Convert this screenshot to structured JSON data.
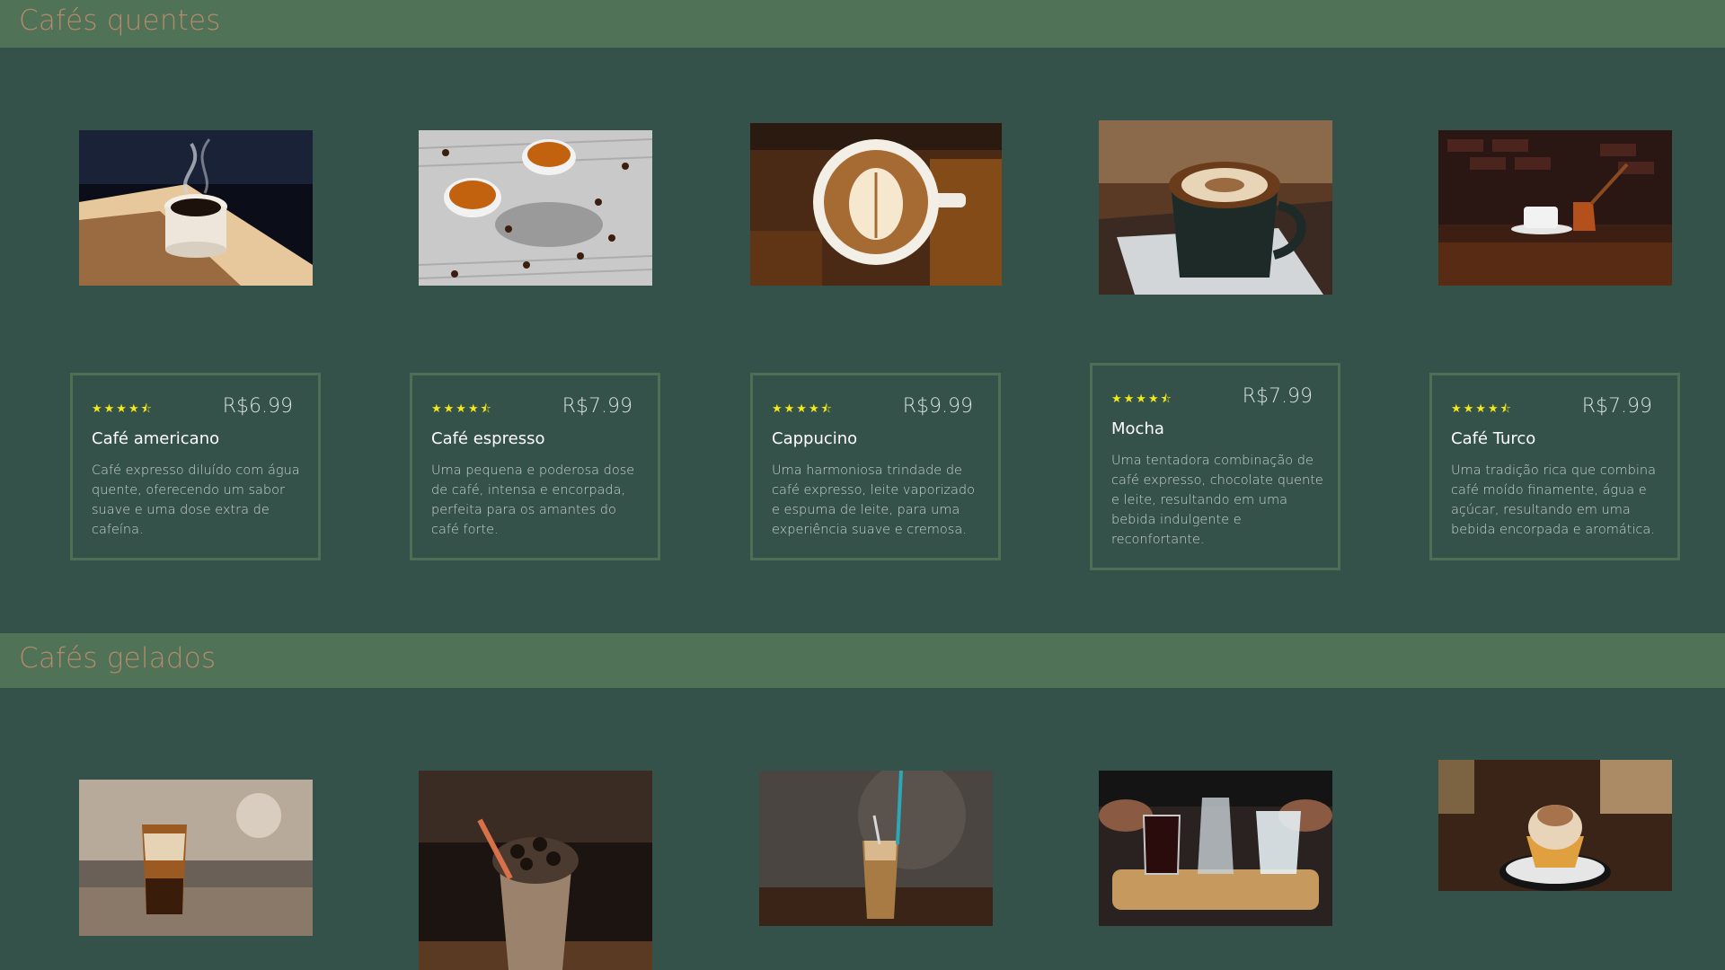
{
  "sections": [
    {
      "title": "Cafés quentes",
      "products": [
        {
          "name": "Café americano",
          "price": "R$6.99",
          "rating": 4.5,
          "stars": "★★★★⯪",
          "description": "Café expresso diluído com água quente, oferecendo um sabor suave e uma dose extra de cafeína.",
          "image_icon": "hot-americano-cup-image"
        },
        {
          "name": "Café espresso",
          "price": "R$7.99",
          "rating": 4.5,
          "stars": "★★★★⯪",
          "description": "Uma pequena e poderosa dose de café, intensa e encorpada, perfeita para os amantes do café forte.",
          "image_icon": "espresso-cups-image"
        },
        {
          "name": "Cappucino",
          "price": "R$9.99",
          "rating": 4.5,
          "stars": "★★★★⯪",
          "description": "Uma harmoniosa trindade de café expresso, leite vaporizado e espuma de leite, para uma experiência suave e cremosa.",
          "image_icon": "cappuccino-latte-art-image"
        },
        {
          "name": "Mocha",
          "price": "R$7.99",
          "rating": 4.5,
          "stars": "★★★★⯪",
          "description": "Uma tentadora combinação de café expresso, chocolate quente e leite, resultando em uma bebida indulgente e reconfortante.",
          "image_icon": "mocha-cup-image"
        },
        {
          "name": "Café Turco",
          "price": "R$7.99",
          "rating": 4.5,
          "stars": "★★★★⯪",
          "description": "Uma tradição rica que combina café moído finamente, água e açúcar, resultando em uma bebida encorpada e aromática.",
          "image_icon": "turkish-coffee-pot-image"
        }
      ]
    },
    {
      "title": "Cafés gelados",
      "products": [
        {
          "image_icon": "iced-latte-glass-image"
        },
        {
          "image_icon": "frappe-cookies-cup-image"
        },
        {
          "image_icon": "iced-coffee-straw-image"
        },
        {
          "image_icon": "cold-brew-tray-image"
        },
        {
          "image_icon": "affogato-dessert-image"
        }
      ]
    }
  ],
  "colors": {
    "background": "#34524a",
    "header_bar": "#507257",
    "header_text": "#b58a6a",
    "card_border": "#4f6e56",
    "star": "#f2e81a"
  }
}
